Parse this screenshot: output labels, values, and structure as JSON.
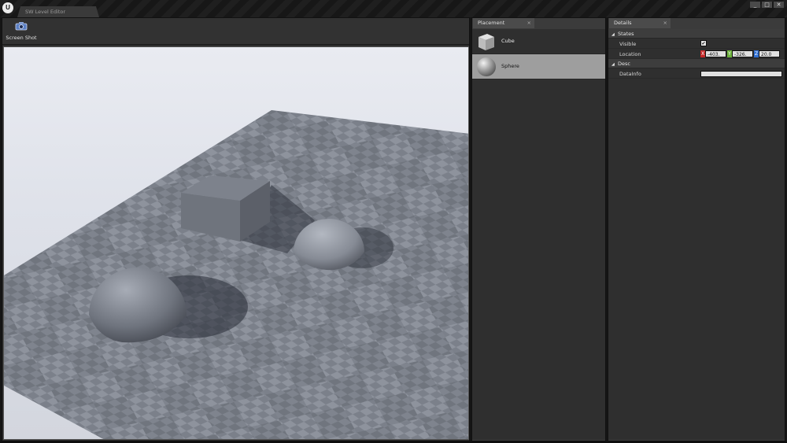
{
  "window": {
    "tab_title": "SW Level Editor",
    "controls": [
      "_",
      "□",
      "✕"
    ]
  },
  "toolbar": {
    "screenshot_label": "Screen Shot"
  },
  "placement": {
    "tab_label": "Placement",
    "tab_close": "×",
    "items": [
      {
        "label": "Cube",
        "icon": "cube-icon",
        "selected": false
      },
      {
        "label": "Sphere",
        "icon": "sphere-icon",
        "selected": true
      }
    ]
  },
  "details": {
    "tab_label": "Details",
    "tab_close": "×",
    "categories": [
      {
        "label": "States",
        "arrow": "◢"
      },
      {
        "label": "Desc",
        "arrow": "◢"
      }
    ],
    "visible_label": "Visible",
    "visible_checked": "✔",
    "location_label": "Location",
    "location": {
      "x_axis": "X",
      "x": "-403.",
      "y_axis": "Y",
      "y": "-326.",
      "z_axis": "Z",
      "z": "20.0"
    },
    "datainfo_label": "DataInfo",
    "datainfo_value": ""
  },
  "colors": {
    "axis_x": "#c62828",
    "axis_y": "#6cb23b",
    "axis_z": "#2f6fd3",
    "selection": "#9e9e9e"
  }
}
